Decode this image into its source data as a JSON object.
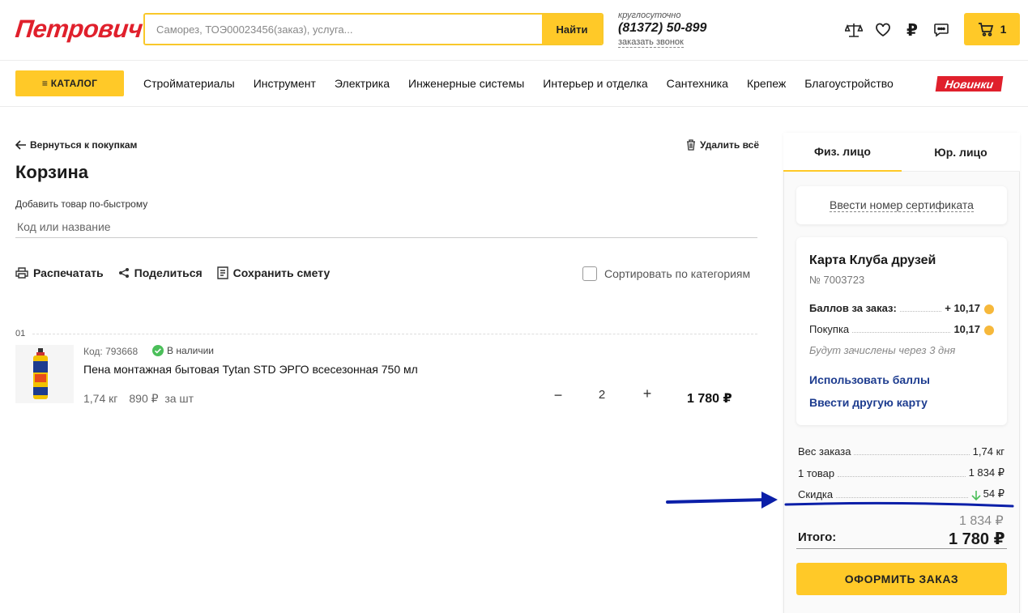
{
  "header": {
    "logo": "Петрович",
    "search_placeholder": "Саморез, ТОЭ00023456(заказ), услуга...",
    "search_button": "Найти",
    "phone_note": "круглосуточно",
    "phone": "(81372) 50-899",
    "callback": "заказать звонок",
    "icons": [
      "scales-icon",
      "heart-icon",
      "ruble-icon",
      "chat-icon"
    ],
    "cart_count": "1"
  },
  "nav": {
    "catalog": "≡ КАТАЛОГ",
    "items": [
      "Стройматериалы",
      "Инструмент",
      "Электрика",
      "Инженерные системы",
      "Интерьер и отделка",
      "Сантехника",
      "Крепеж",
      "Благоустройство"
    ],
    "new_badge": "Новинки"
  },
  "cart": {
    "back": "Вернуться к покупкам",
    "delete_all": "Удалить всё",
    "title": "Корзина",
    "quick_add_label": "Добавить товар по-быстрому",
    "quick_add_placeholder": "Код или название",
    "tools": {
      "print": "Распечатать",
      "share": "Поделиться",
      "save": "Сохранить смету"
    },
    "sort_label": "Сортировать по категориям",
    "item": {
      "index": "01",
      "code": "Код: 793668",
      "stock": "В наличии",
      "name": "Пена монтажная бытовая Tytan STD ЭРГО всесезонная 750 мл",
      "weight": "1,74 кг",
      "unit_price": "890 ₽",
      "unit": "за шт",
      "qty": "2",
      "minus": "−",
      "plus": "+",
      "total": "1 780 ₽"
    }
  },
  "summary": {
    "tab_individual": "Физ. лицо",
    "tab_legal": "Юр. лицо",
    "certificate": "Ввести номер сертификата",
    "club_card": {
      "title": "Карта Клуба друзей",
      "number": "№ 7003723",
      "points_label": "Баллов за заказ:",
      "points_value": "+ 10,17",
      "purchase_label": "Покупка",
      "purchase_value": "10,17",
      "note": "Будут зачислены через 3 дня",
      "use_points": "Использовать баллы",
      "other_card": "Ввести другую карту"
    },
    "weight_label": "Вес заказа",
    "weight_value": "1,74 кг",
    "items_label": "1 товар",
    "items_value": "1 834 ₽",
    "discount_label": "Скидка",
    "discount_value": "54 ₽",
    "old_total": "1 834 ₽",
    "total_label": "Итого:",
    "total_value": "1 780 ₽",
    "checkout": "ОФОРМИТЬ ЗАКАЗ"
  },
  "colors": {
    "brand_red": "#e0202c",
    "accent_yellow": "#ffc928",
    "link_blue": "#1d3c8f",
    "annotation_blue": "#0b1fa8"
  }
}
